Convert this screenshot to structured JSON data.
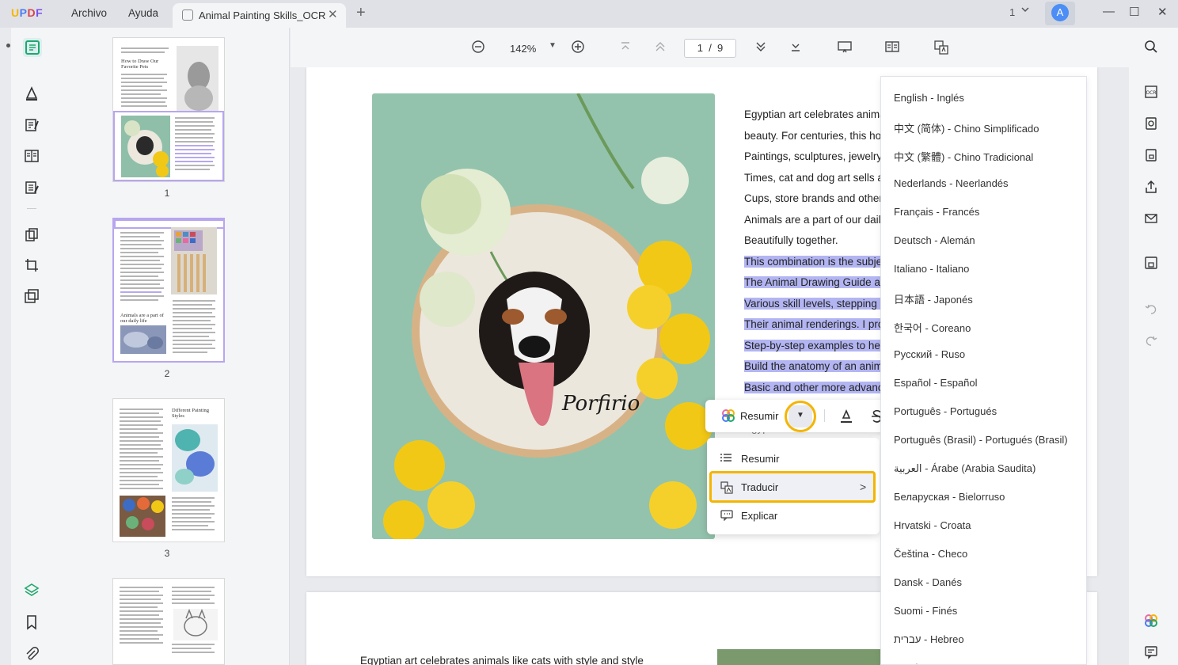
{
  "app": {
    "logo": "UPDF",
    "menu": [
      "Archivo",
      "Ayuda"
    ],
    "tab_title": "Animal Painting Skills_OCR",
    "page_count_selector": "1",
    "avatar_letter": "A"
  },
  "toolbar": {
    "zoom": "142%",
    "page_current": "1",
    "page_separator": "/",
    "page_total": "9"
  },
  "thumbnails": [
    {
      "number": "1",
      "title": "How to Draw Our Favorite Pets"
    },
    {
      "number": "2",
      "title": "Animals are a part of our daily life"
    },
    {
      "number": "3",
      "title": "Different Painting Styles"
    },
    {
      "number": "4",
      "title": ""
    }
  ],
  "page_text": {
    "lines": [
      "Egyptian art celebrates anima",
      "beauty. For centuries, this ho",
      "Paintings, sculptures, jewelry",
      "Times, cat and dog art sells a",
      "Cups, store brands and other",
      "Animals are a part of our daily",
      "Beautifully together."
    ],
    "highlighted_lines": [
      "This combination is the subjec",
      "The Animal Drawing Guide ai",
      "Various skill levels, stepping s",
      "Their animal renderings. I pro",
      "Step-by-step examples to hel",
      "Build the anatomy of an anim",
      "Basic and other more advanc"
    ],
    "partial_line": "Egyptian art celebrates anim",
    "page2_line": "Egyptian art celebrates animals like cats with style and style",
    "hoop_signature": "Porfirio"
  },
  "selection_toolbar": {
    "summarize_label": "Resumir",
    "dropdown_arrow": "▼"
  },
  "ai_menu": {
    "items": [
      {
        "label": "Resumir",
        "icon": "list-icon"
      },
      {
        "label": "Traducir",
        "icon": "translate-icon"
      },
      {
        "label": "Explicar",
        "icon": "explain-icon"
      }
    ],
    "submenu_arrow": ">"
  },
  "languages": [
    "English - Inglés",
    "中文 (简体) - Chino Simplificado",
    "中文 (繁體) - Chino Tradicional",
    "Nederlands - Neerlandés",
    "Français - Francés",
    "Deutsch - Alemán",
    "Italiano - Italiano",
    "日本語 - Japonés",
    "한국어 - Coreano",
    "Русский - Ruso",
    "Español - Español",
    "Português - Portugués",
    "Português (Brasil) - Portugués (Brasil)",
    "العربية - Árabe (Arabia Saudita)",
    "Беларуская - Bielorruso",
    "Hrvatski - Croata",
    "Čeština - Checo",
    "Dansk - Danés",
    "Suomi - Finés",
    "עברית - Hebreo",
    "Norsk - Noruego"
  ],
  "colors": {
    "accent": "#f4b500",
    "highlight": "#b3b5f2",
    "selected_thumb": "#b8a6ee"
  }
}
